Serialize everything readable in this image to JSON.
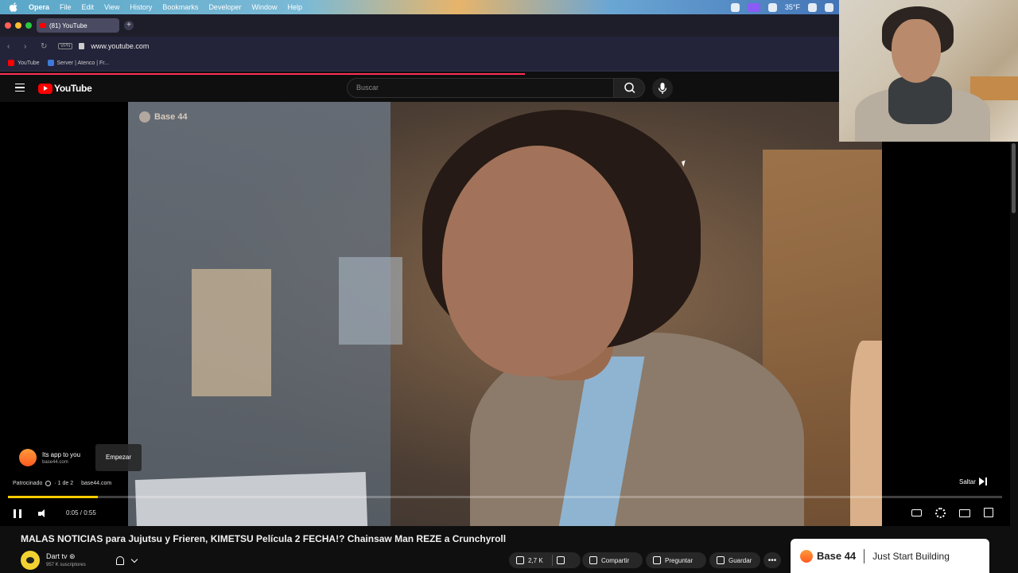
{
  "menubar": {
    "app": "Opera",
    "items": [
      "File",
      "Edit",
      "View",
      "History",
      "Bookmarks",
      "Developer",
      "Window",
      "Help"
    ],
    "temperature": "35°F"
  },
  "browser": {
    "tab_title": "(81) YouTube",
    "url": "www.youtube.com",
    "vpn_label": "VPN",
    "bookmarks": [
      {
        "label": "YouTube",
        "color": "#ff0000"
      },
      {
        "label": "Server | Atenco | Fr...",
        "color": "#3d7bd9"
      }
    ]
  },
  "youtube": {
    "logo": "YouTube",
    "search_placeholder": "Buscar"
  },
  "player": {
    "ad_brand": "Base 44",
    "ad_card": {
      "title": "Its app to you",
      "domain": "base44.com",
      "cta": "Empezar"
    },
    "sponsor": {
      "label": "Patrocinado",
      "count": "· 1 de 2",
      "domain": "base44.com"
    },
    "skip_label": "Saltar",
    "time": "0:05 / 0:55",
    "progress_fraction": 0.09,
    "accent": "#ffcc00"
  },
  "video": {
    "title": "MALAS NOTICIAS para Jujutsu y Frieren, KIMETSU Película 2 FECHA!? Chainsaw Man REZE a Crunchyroll",
    "channel": "Dart tv ⊛",
    "subscribers": "957 K suscriptores",
    "likes": "2,7 K",
    "share": "Compartir",
    "ask": "Preguntar",
    "save": "Guardar",
    "more": "•••"
  },
  "banner": {
    "brand": "Base 44",
    "tagline": "Just Start Building"
  }
}
